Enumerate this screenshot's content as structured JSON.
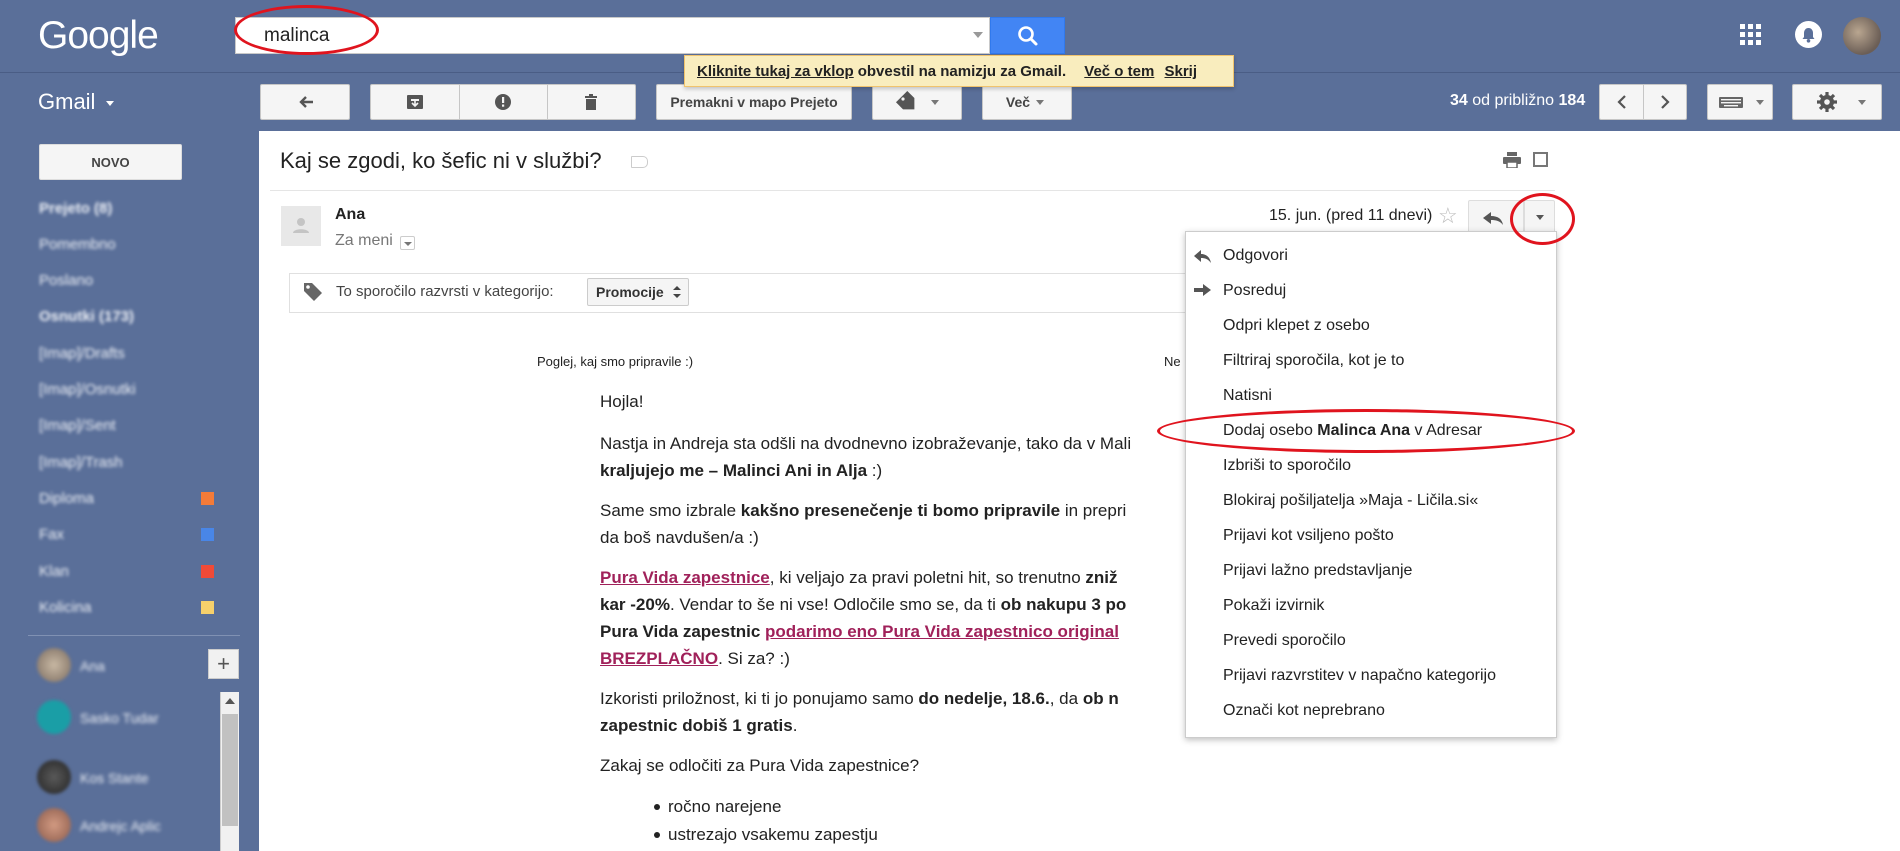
{
  "header": {
    "logo": "Google",
    "search_value": "malinca"
  },
  "app": {
    "label": "Gmail"
  },
  "notification": {
    "enable_text": "Kliknite tukaj za vklop",
    "rest_text": "obvestil na namizju za Gmail.",
    "more_link": "Več o tem",
    "hide_link": "Skrij"
  },
  "toolbar": {
    "move_label": "Premakni v mapo Prejeto",
    "more_label": "Več",
    "count_current": "34",
    "count_rest": "od približno",
    "count_total": "184"
  },
  "sidebar": {
    "compose_label": "NOVO",
    "items": [
      {
        "label": "Prejeto (8)",
        "bold": true
      },
      {
        "label": "Pomembno"
      },
      {
        "label": "Poslano"
      },
      {
        "label": "Osnutki (173)",
        "bold": true
      },
      {
        "label": "[Imap]/Drafts"
      },
      {
        "label": "[Imap]/Osnutki"
      },
      {
        "label": "[Imap]/Sent"
      },
      {
        "label": "[Imap]/Trash"
      },
      {
        "label": "Diploma",
        "color": "#f47b38"
      },
      {
        "label": "Fax",
        "color": "#4986e7"
      },
      {
        "label": "Klan",
        "color": "#f04a37"
      },
      {
        "label": "Kolicina",
        "color": "#f6d06b"
      }
    ],
    "contacts": [
      {
        "name": "Ana"
      },
      {
        "name": "Sasko Tudar"
      },
      {
        "name": "Kos Stante"
      },
      {
        "name": "Andrejc Aplic"
      }
    ]
  },
  "email": {
    "subject": "Kaj se zgodi, ko šefic ni v službi?",
    "sender": "Ana",
    "to_me": "Za meni",
    "date": "15. jun. (pred 11 dnevi)",
    "category_text": "To sporočilo razvrsti v kategorijo:",
    "category_value": "Promocije",
    "preheader": "Poglej, kaj smo pripravile :)",
    "preheader_right": "Ne",
    "body": {
      "greeting": "Hojla!",
      "p1_a": "Nastja in Andreja sta odšli na dvodnevno izobraževanje, tako da v Mali",
      "p1_b": "kraljujejo me – Malinci Ani in Alja",
      "p1_c": " :)",
      "p2_a": "Same smo izbrale ",
      "p2_b": "kakšno presenečenje ti bomo pripravile",
      "p2_c": " in prepri",
      "p2_d": "da boš navdušen/a :)",
      "p3_link1": "Pura Vida zapestnice",
      "p3_a": ", ki veljajo za pravi poletni hit, so trenutno ",
      "p3_b": "zniž",
      "p3_c": "kar -20%",
      "p3_d": ". Vendar to še ni vse! Odločile smo se, da ti ",
      "p3_e": "ob nakupu 3 po",
      "p3_f": "Pura Vida zapestnic ",
      "p3_link2": "podarimo eno Pura Vida zapestnico original",
      "p3_link3": "BREZPLAČNO",
      "p3_g": ". Si za? :)",
      "p4_a": "Izkoristi priložnost, ki ti jo ponujamo samo ",
      "p4_b": "do nedelje, 18.6.",
      "p4_c": ", da ",
      "p4_d": "ob n",
      "p4_e": "zapestnic dobiš 1 gratis",
      "p4_f": ".",
      "p5": "Zakaj se odločiti za Pura Vida zapestnice?",
      "bullets": [
        "ročno narejene",
        "ustrezajo vsakemu zapestju"
      ]
    }
  },
  "menu": {
    "reply": "Odgovori",
    "forward": "Posreduj",
    "open_chat": "Odpri klepet z osebo",
    "filter": "Filtriraj sporočila, kot je to",
    "print": "Natisni",
    "add_a": "Dodaj osebo",
    "add_b": "Malinca Ana",
    "add_c": "v Adresar",
    "delete": "Izbriši to sporočilo",
    "block": "Blokiraj pošiljatelja »Maja - Ličila.si«",
    "spam": "Prijavi kot vsiljeno pošto",
    "phishing": "Prijavi lažno predstavljanje",
    "source": "Pokaži izvirnik",
    "translate": "Prevedi sporočilo",
    "misclass": "Prijavi razvrstitev v napačno kategorijo",
    "unread": "Označi kot neprebrano"
  }
}
